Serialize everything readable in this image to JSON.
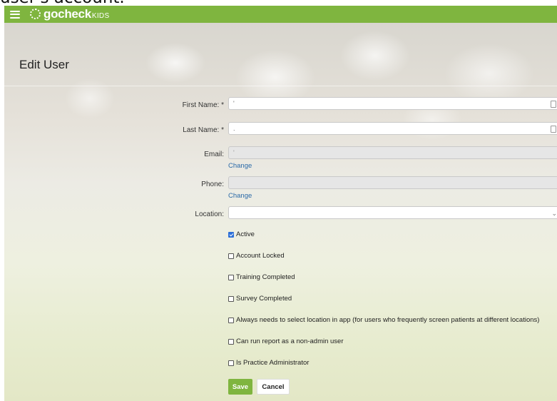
{
  "caption": "user's account.",
  "app": {
    "brand_word": "gocheck",
    "brand_sub": "KIDS",
    "brand_color": "#7fb53f"
  },
  "page": {
    "title": "Edit User"
  },
  "form": {
    "first_name_label": "First Name: *",
    "last_name_label": "Last Name: *",
    "email_label": "Email:",
    "phone_label": "Phone:",
    "location_label": "Location:",
    "first_name_value": "'",
    "last_name_value": ".",
    "email_value": "'",
    "phone_value": "",
    "location_value": "",
    "change_link_email": "Change",
    "change_link_phone": "Change"
  },
  "checkboxes": {
    "active": {
      "label": "Active",
      "checked": true
    },
    "account_locked": {
      "label": "Account Locked",
      "checked": false
    },
    "training_completed": {
      "label": "Training Completed",
      "checked": false
    },
    "survey_completed": {
      "label": "Survey Completed",
      "checked": false
    },
    "select_location": {
      "label": "Always needs to select location in app (for users who frequently screen patients at different locations)",
      "checked": false
    },
    "run_report": {
      "label": "Can run report as a non-admin user",
      "checked": false
    },
    "practice_admin": {
      "label": "Is Practice Administrator",
      "checked": false
    }
  },
  "buttons": {
    "save": "Save",
    "cancel": "Cancel"
  },
  "icons": {
    "menu": "hamburger-menu-icon",
    "logo": "gocheck-logo-icon",
    "autofill": "contact-card-icon",
    "dropdown": "chevron-down-icon"
  }
}
